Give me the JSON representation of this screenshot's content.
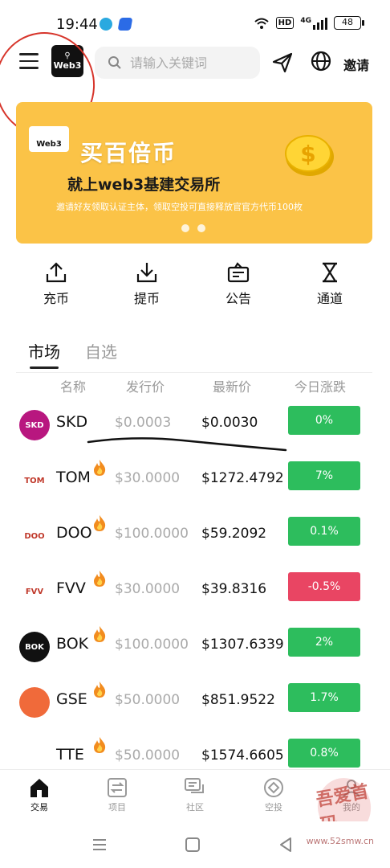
{
  "status_bar": {
    "time": "19:44",
    "network_label": "HD",
    "signal_label": "4G",
    "battery": "48"
  },
  "header": {
    "logo_text": "Web3",
    "search_placeholder": "请输入关键词",
    "invite_label": "邀请"
  },
  "banner": {
    "logo_text": "Web3",
    "title": "买百倍币",
    "subtitle": "就上web3基建交易所",
    "description": "邀请好友领取认证主体，领取空投可直接释放官官方代币100枚",
    "dot_count": 2
  },
  "actions": [
    {
      "label": "充币",
      "icon": "upload-icon"
    },
    {
      "label": "提币",
      "icon": "download-icon"
    },
    {
      "label": "公告",
      "icon": "announcement-icon"
    },
    {
      "label": "通道",
      "icon": "hourglass-icon"
    }
  ],
  "tabs": [
    {
      "label": "市场",
      "active": true
    },
    {
      "label": "自选",
      "active": false
    }
  ],
  "table": {
    "headers": [
      "名称",
      "发行价",
      "最新价",
      "今日涨跌"
    ],
    "rows": [
      {
        "symbol": "SKD",
        "issue": "$0.0003",
        "latest": "$0.0030",
        "change": "0%",
        "hot": false,
        "color": "#2dbd5d",
        "icon_bg": "#b8177f",
        "icon_text": "SKD"
      },
      {
        "symbol": "TOM",
        "issue": "$30.0000",
        "latest": "$1272.4792",
        "change": "7%",
        "hot": true,
        "color": "#2dbd5d",
        "icon_bg": "#ffffff",
        "icon_text": "TOM"
      },
      {
        "symbol": "DOO",
        "issue": "$100.0000",
        "latest": "$59.2092",
        "change": "0.1%",
        "hot": true,
        "color": "#2dbd5d",
        "icon_bg": "#ffffff",
        "icon_text": "DOO"
      },
      {
        "symbol": "FVV",
        "issue": "$30.0000",
        "latest": "$39.8316",
        "change": "-0.5%",
        "hot": true,
        "color": "#e94563",
        "icon_bg": "#ffffff",
        "icon_text": "FVV"
      },
      {
        "symbol": "BOK",
        "issue": "$100.0000",
        "latest": "$1307.6339",
        "change": "2%",
        "hot": true,
        "color": "#2dbd5d",
        "icon_bg": "#111111",
        "icon_text": "BOK"
      },
      {
        "symbol": "GSE",
        "issue": "$50.0000",
        "latest": "$851.9522",
        "change": "1.7%",
        "hot": true,
        "color": "#2dbd5d",
        "icon_bg": "#f06a3a",
        "icon_text": ""
      },
      {
        "symbol": "TTE",
        "issue": "$50.0000",
        "latest": "$1574.6605",
        "change": "0.8%",
        "hot": true,
        "color": "#2dbd5d",
        "icon_bg": "#ffffff",
        "icon_text": ""
      }
    ]
  },
  "bottom_nav": [
    {
      "label": "交易",
      "active": true,
      "icon": "home-icon"
    },
    {
      "label": "项目",
      "active": false,
      "icon": "swap-icon"
    },
    {
      "label": "社区",
      "active": false,
      "icon": "chat-icon"
    },
    {
      "label": "空投",
      "active": false,
      "icon": "airdrop-icon"
    },
    {
      "label": "我的",
      "active": false,
      "icon": "profile-icon"
    }
  ],
  "watermark": "www.52smw.cn",
  "stamp_text": "吾爱首码",
  "colors": {
    "banner": "#fbc347",
    "up": "#2dbd5d",
    "down": "#e94563",
    "annotation": "#d7352b"
  }
}
